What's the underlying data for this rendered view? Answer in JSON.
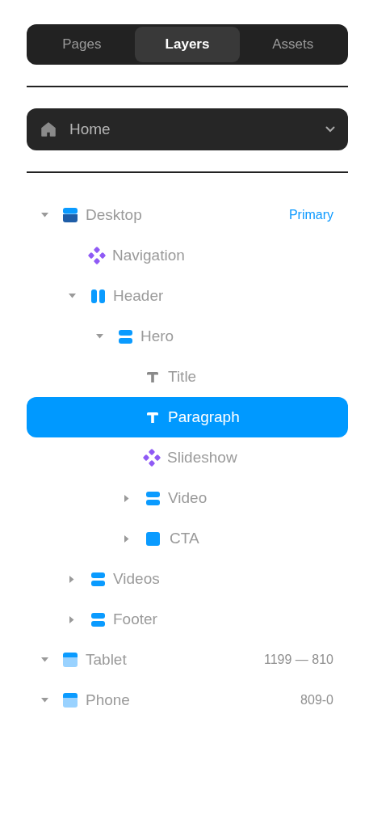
{
  "tabs": [
    {
      "label": "Pages",
      "selected": false
    },
    {
      "label": "Layers",
      "selected": true
    },
    {
      "label": "Assets",
      "selected": false
    }
  ],
  "page_select": {
    "value": "Home"
  },
  "layers": [
    {
      "name": "Desktop",
      "kind": "frame",
      "expanded": true,
      "selected": false,
      "badge": {
        "text": "Primary",
        "kind": "primary"
      },
      "children": [
        {
          "name": "Navigation",
          "kind": "component",
          "selected": false
        },
        {
          "name": "Header",
          "kind": "hstack",
          "expanded": true,
          "selected": false,
          "children": [
            {
              "name": "Hero",
              "kind": "vstack",
              "expanded": true,
              "selected": false,
              "children": [
                {
                  "name": "Title",
                  "kind": "text",
                  "selected": false
                },
                {
                  "name": "Paragraph",
                  "kind": "text",
                  "selected": true
                },
                {
                  "name": "Slideshow",
                  "kind": "component",
                  "selected": false
                },
                {
                  "name": "Video",
                  "kind": "vstack",
                  "expanded": false,
                  "selected": false
                },
                {
                  "name": "CTA",
                  "kind": "box",
                  "expanded": false,
                  "selected": false
                }
              ]
            }
          ]
        },
        {
          "name": "Videos",
          "kind": "vstack",
          "expanded": false,
          "selected": false
        },
        {
          "name": "Footer",
          "kind": "vstack",
          "expanded": false,
          "selected": false
        }
      ]
    },
    {
      "name": "Tablet",
      "kind": "breakpoint",
      "expanded": true,
      "selected": false,
      "badge": {
        "text": "1199 — 810",
        "kind": "range"
      }
    },
    {
      "name": "Phone",
      "kind": "breakpoint",
      "expanded": true,
      "selected": false,
      "badge": {
        "text": "809-0",
        "kind": "range"
      }
    }
  ]
}
